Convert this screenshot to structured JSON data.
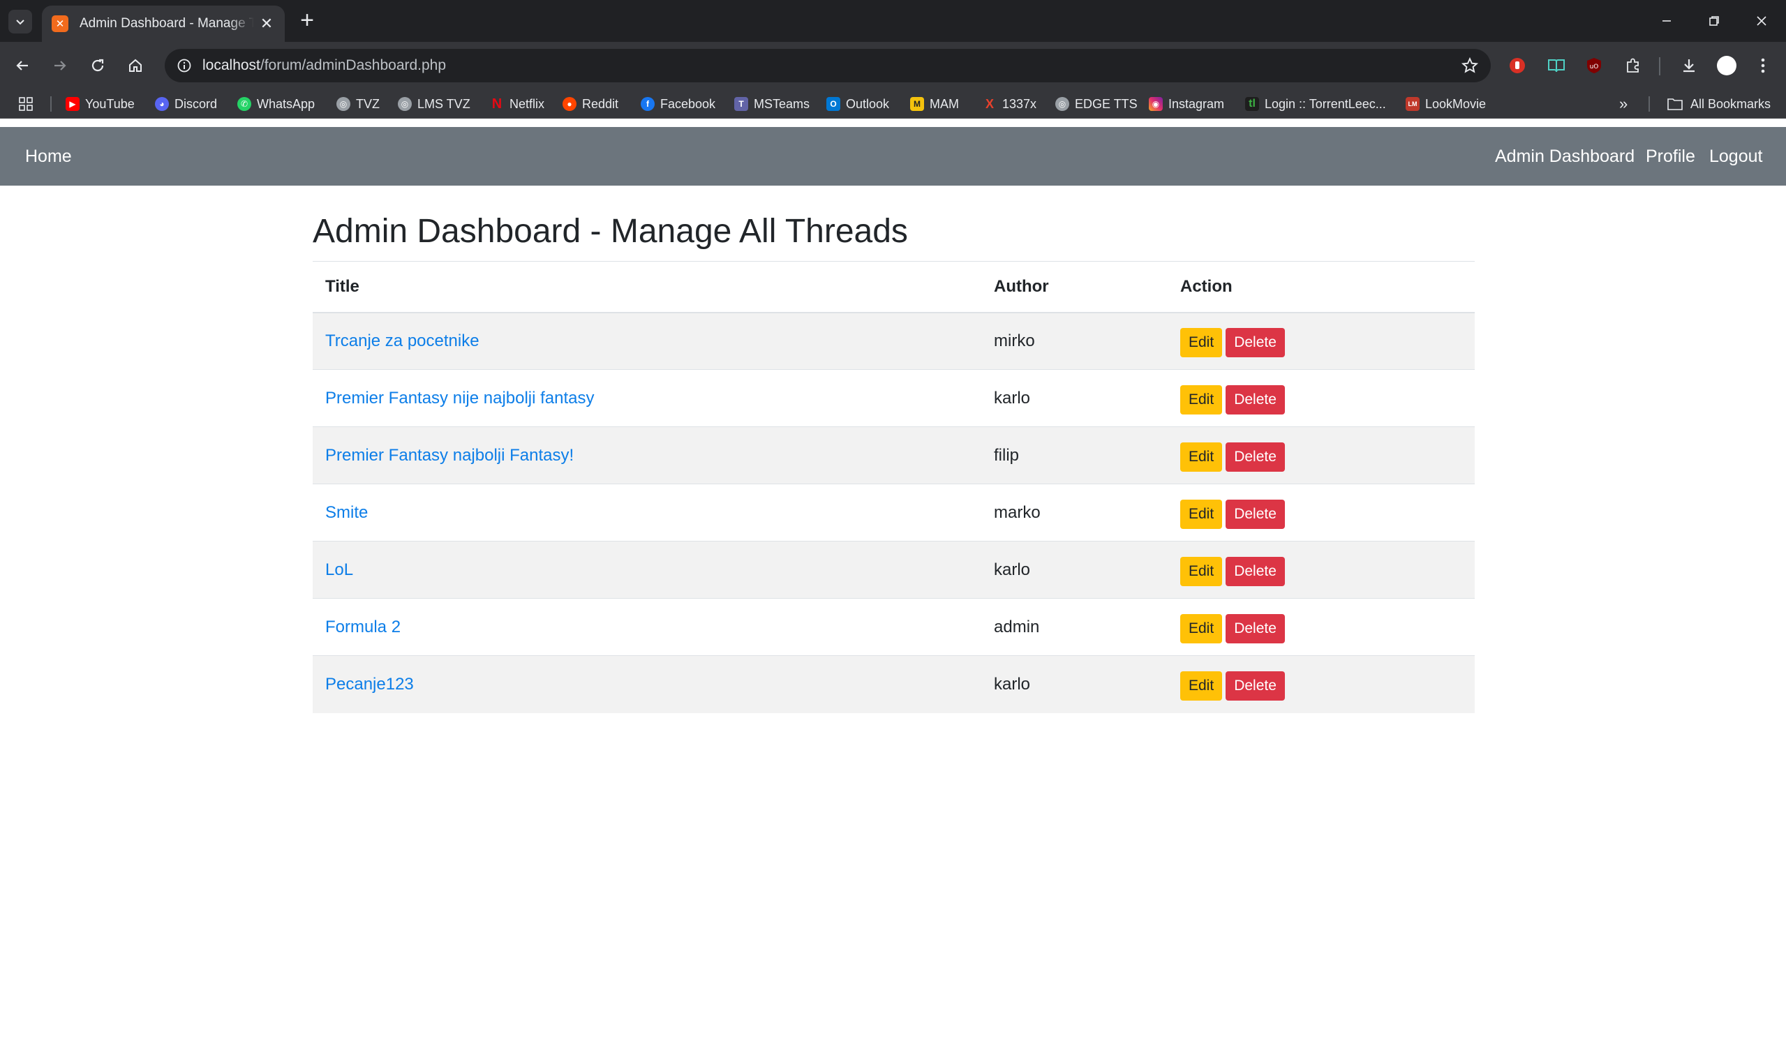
{
  "browser": {
    "tab": {
      "title": "Admin Dashboard - Manage Threads"
    },
    "address": {
      "host": "localhost",
      "path": "/forum/adminDashboard.php"
    },
    "bookmarks": [
      {
        "label": "YouTube",
        "icon": "youtube-icon",
        "color": "#ff0000"
      },
      {
        "label": "Discord",
        "icon": "discord-icon",
        "color": "#5865f2"
      },
      {
        "label": "WhatsApp",
        "icon": "whatsapp-icon",
        "color": "#25d366"
      },
      {
        "label": "TVZ",
        "icon": "globe-icon",
        "color": "#9aa0a6"
      },
      {
        "label": "LMS TVZ",
        "icon": "globe-icon",
        "color": "#9aa0a6"
      },
      {
        "label": "Netflix",
        "icon": "netflix-icon",
        "color": "#e50914"
      },
      {
        "label": "Reddit",
        "icon": "reddit-icon",
        "color": "#ff4500"
      },
      {
        "label": "Facebook",
        "icon": "facebook-icon",
        "color": "#1877f2"
      },
      {
        "label": "MSTeams",
        "icon": "teams-icon",
        "color": "#6264a7"
      },
      {
        "label": "Outlook",
        "icon": "outlook-icon",
        "color": "#0078d4"
      },
      {
        "label": "MAM",
        "icon": "mam-icon",
        "color": "#f4c20d"
      },
      {
        "label": "1337x",
        "icon": "x-icon",
        "color": "#e8412c"
      },
      {
        "label": "EDGE TTS",
        "icon": "globe-icon",
        "color": "#9aa0a6"
      },
      {
        "label": "Instagram",
        "icon": "instagram-icon",
        "color": "#e1306c"
      },
      {
        "label": "Login :: TorrentLeec...",
        "icon": "torrentleech-icon",
        "color": "#3cb043"
      },
      {
        "label": "LookMovie",
        "icon": "lookmovie-icon",
        "color": "#c0392b"
      }
    ],
    "all_bookmarks": "All Bookmarks"
  },
  "navbar": {
    "home": "Home",
    "admin_dashboard": "Admin Dashboard",
    "profile": "Profile",
    "logout": "Logout"
  },
  "page": {
    "title": "Admin Dashboard - Manage All Threads"
  },
  "table": {
    "headers": {
      "title": "Title",
      "author": "Author",
      "action": "Action"
    },
    "rows": [
      {
        "title": "Trcanje za pocetnike",
        "author": "mirko"
      },
      {
        "title": "Premier Fantasy nije najbolji fantasy",
        "author": "karlo"
      },
      {
        "title": "Premier Fantasy najbolji Fantasy!",
        "author": "filip"
      },
      {
        "title": "Smite",
        "author": "marko"
      },
      {
        "title": "LoL",
        "author": "karlo"
      },
      {
        "title": "Formula 2",
        "author": "admin"
      },
      {
        "title": "Pecanje123",
        "author": "karlo"
      }
    ],
    "edit_label": "Edit",
    "delete_label": "Delete"
  },
  "colors": {
    "navbar_bg": "#6c757d",
    "link": "#0d7ee8",
    "edit_btn": "#ffc107",
    "delete_btn": "#dc3545",
    "stripe": "#f2f2f2"
  }
}
